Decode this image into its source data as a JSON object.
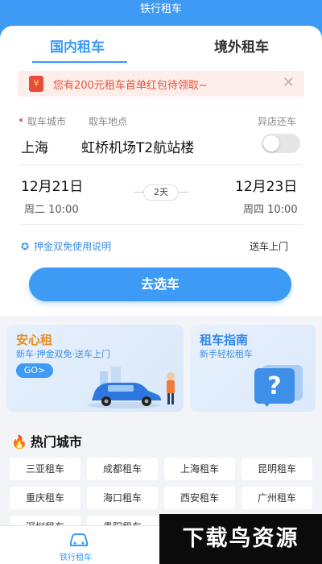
{
  "top_title": "铁行租车",
  "tabs": {
    "domestic": "国内租车",
    "overseas": "境外租车"
  },
  "promo": {
    "text": "您有200元租车首单红包待领取~",
    "icon_symbol": "¥",
    "close_symbol": "✕"
  },
  "form": {
    "pickup_city_label": "取车城市",
    "pickup_location_label": "取车地点",
    "return_other_label": "异店还车",
    "city": "上海",
    "location": "虹桥机场T2航站楼",
    "return_other_toggle": false,
    "start_date": "12月21日",
    "start_sub": "周二  10:00",
    "end_date": "12月23日",
    "end_sub": "周四  10:00",
    "duration": "2天",
    "deposit_text": "押金双免使用说明",
    "delivery_text": "送车上门",
    "submit": "去选车"
  },
  "cards": {
    "anxin": {
      "title": "安心租",
      "sub": "新车·押金双免·送车上门",
      "go": "GO>"
    },
    "guide": {
      "title": "租车指南",
      "sub": "新手轻松租车"
    }
  },
  "hot_cities": {
    "title": "热门城市",
    "items": [
      "三亚租车",
      "成都租车",
      "上海租车",
      "昆明租车",
      "重庆租车",
      "海口租车",
      "西安租车",
      "广州租车",
      "深圳租车",
      "贵阳租车",
      "",
      ""
    ]
  },
  "bottom_nav": {
    "label": "铁行租车"
  },
  "watermark": "下载鸟资源",
  "colors": {
    "primary": "#3d9bf5",
    "promo_red": "#e4543c",
    "accent_orange": "#ea8a1c"
  }
}
